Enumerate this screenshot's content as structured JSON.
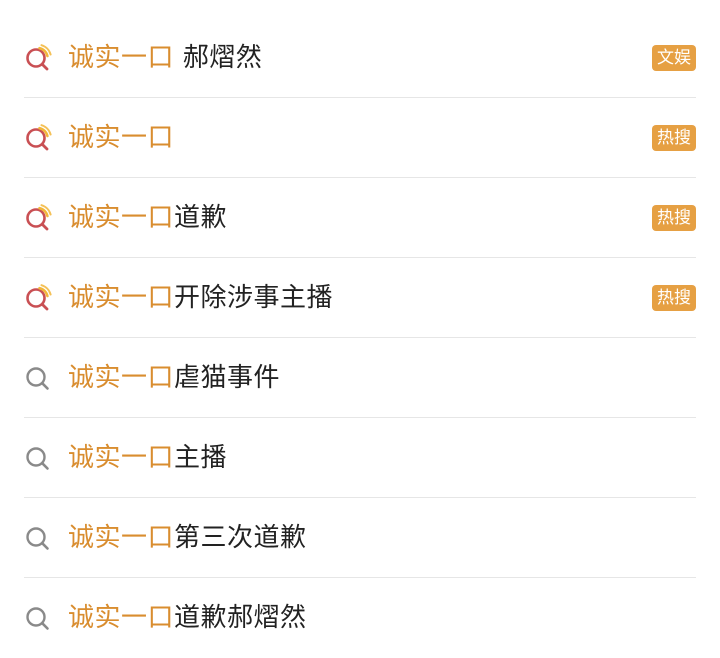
{
  "colors": {
    "keyword": "#d98d2f",
    "text": "#222222",
    "badge_bg": "#e6a043",
    "hot_icon_ring": "#c95054",
    "hot_icon_arc": "#f2b63a",
    "plain_icon": "#8a8a8a",
    "divider": "#e6e6e6"
  },
  "suggestions": [
    {
      "keyword": "诚实一口",
      "rest": " 郝熠然",
      "icon": "hot-search-icon",
      "badge": "文娱"
    },
    {
      "keyword": "诚实一口",
      "rest": "",
      "icon": "hot-search-icon",
      "badge": "热搜"
    },
    {
      "keyword": "诚实一口",
      "rest": "道歉",
      "icon": "hot-search-icon",
      "badge": "热搜"
    },
    {
      "keyword": "诚实一口",
      "rest": "开除涉事主播",
      "icon": "hot-search-icon",
      "badge": "热搜"
    },
    {
      "keyword": "诚实一口",
      "rest": "虐猫事件",
      "icon": "search-icon",
      "badge": ""
    },
    {
      "keyword": "诚实一口",
      "rest": "主播",
      "icon": "search-icon",
      "badge": ""
    },
    {
      "keyword": "诚实一口",
      "rest": "第三次道歉",
      "icon": "search-icon",
      "badge": ""
    },
    {
      "keyword": "诚实一口",
      "rest": "道歉郝熠然",
      "icon": "search-icon",
      "badge": ""
    }
  ]
}
